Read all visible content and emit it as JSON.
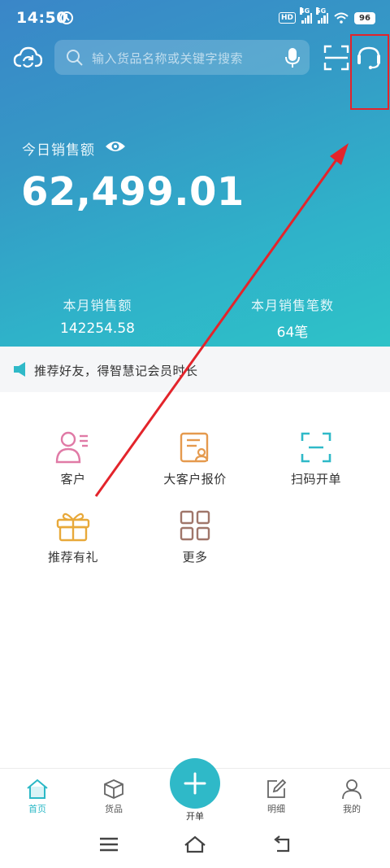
{
  "status_bar": {
    "time": "14:50",
    "hd_label": "HD",
    "signal1_label": "4G",
    "signal2_label": "5G",
    "battery": "96"
  },
  "toolbar": {
    "search_placeholder": "输入货品名称或关键字搜索"
  },
  "sales": {
    "today_label": "今日销售额",
    "today_amount": "62,499.01",
    "month_amount_label": "本月销售额",
    "month_amount": "142254.58",
    "month_count_label": "本月销售笔数",
    "month_count": "64笔"
  },
  "notice": {
    "text": "推荐好友，得智慧记会员时长"
  },
  "features": [
    {
      "label": "客户",
      "icon": "customer-icon"
    },
    {
      "label": "大客户报价",
      "icon": "quote-icon"
    },
    {
      "label": "扫码开单",
      "icon": "scan-order-icon"
    },
    {
      "label": "推荐有礼",
      "icon": "gift-icon"
    },
    {
      "label": "更多",
      "icon": "more-grid-icon"
    }
  ],
  "tabs": [
    {
      "label": "首页",
      "icon": "home-icon",
      "active": true
    },
    {
      "label": "货品",
      "icon": "box-icon",
      "active": false
    },
    {
      "label": "开单",
      "icon": "plus-icon",
      "active": false
    },
    {
      "label": "明细",
      "icon": "edit-icon",
      "active": false
    },
    {
      "label": "我的",
      "icon": "user-icon",
      "active": false
    }
  ],
  "colors": {
    "accent": "#2fb9c8",
    "annotation": "#e3242b",
    "gift": "#e8a93a",
    "customer": "#e07aa6",
    "quote": "#e59a4e",
    "more": "#a0766a"
  }
}
